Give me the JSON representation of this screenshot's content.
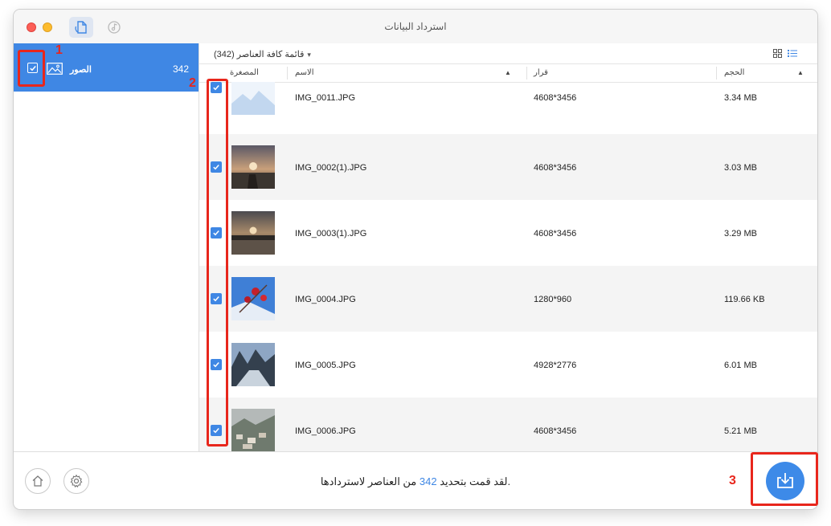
{
  "window": {
    "title": "استرداد البيانات"
  },
  "colors": {
    "accent": "#3f87e4",
    "annotation": "#e8261c"
  },
  "sidebar": {
    "items": [
      {
        "label": "الصور",
        "count": "342",
        "icon": "photo-icon",
        "checked": true,
        "selected": true
      }
    ]
  },
  "list": {
    "title": "قائمة كافة العناصر (342)",
    "columns": {
      "thumbnail": "المصغرة",
      "name": "الاسم",
      "resolution": "قرار",
      "size": "الحجم"
    },
    "rows": [
      {
        "name": "IMG_0011.JPG",
        "resolution": "4608*3456",
        "size": "3.34 MB",
        "checked": true
      },
      {
        "name": "IMG_0002(1).JPG",
        "resolution": "4608*3456",
        "size": "3.03 MB",
        "checked": true
      },
      {
        "name": "IMG_0003(1).JPG",
        "resolution": "4608*3456",
        "size": "3.29 MB",
        "checked": true
      },
      {
        "name": "IMG_0004.JPG",
        "resolution": "1280*960",
        "size": "119.66 KB",
        "checked": true
      },
      {
        "name": "IMG_0005.JPG",
        "resolution": "4928*2776",
        "size": "6.01 MB",
        "checked": true
      },
      {
        "name": "IMG_0006.JPG",
        "resolution": "4608*3456",
        "size": "5.21 MB",
        "checked": true
      }
    ]
  },
  "footer": {
    "status_prefix": "لقد قمت بتحديد",
    "status_count": "342",
    "status_suffix": "من العناصر لاستردادها."
  },
  "annotations": {
    "one": "1",
    "two": "2",
    "three": "3"
  }
}
